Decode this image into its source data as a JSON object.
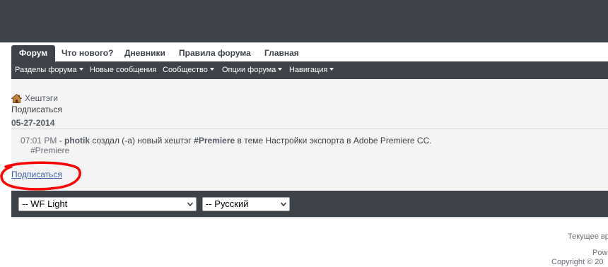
{
  "tabs": [
    "Форум",
    "Что нового?",
    "Дневники",
    "Правила форума",
    "Главная"
  ],
  "subnav": [
    "Разделы форума",
    "Новые сообщения",
    "Сообщество",
    "Опции форума",
    "Навигация"
  ],
  "breadcrumb": {
    "label": "Хештэги",
    "icon": "home-icon"
  },
  "subscribe_top": "Подписаться",
  "date": "05-27-2014",
  "activity": {
    "time": "07:01 PM",
    "separator": " - ",
    "user": "photik",
    "action": " создал (-а) новый хештэг ",
    "hashtag": "#Premiere",
    "in_topic": " в теме ",
    "topic": "Настройки экспорта в Adobe Premiere CC.",
    "tag": "#Premiere"
  },
  "subscribe_bottom": "Подписаться",
  "selects": {
    "style": "-- WF Light",
    "language": "-- Русский"
  },
  "footer": {
    "time_note": "Текущее вр",
    "powered": "Pow",
    "copyright": "Copyright © 20"
  },
  "colors": {
    "dark": "#3e434a",
    "annotation": "#ff0000",
    "link": "#3a5faa"
  }
}
